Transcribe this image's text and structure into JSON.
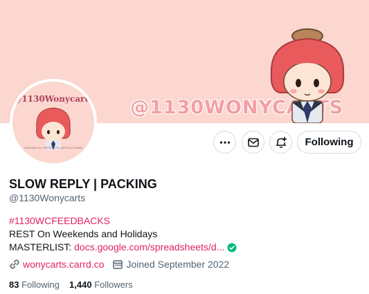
{
  "banner": {
    "text": "@1130WONYCARTS"
  },
  "avatar": {
    "title": "@1130Wonycarts",
    "caption": "ONGOING ALL PRODUCTS | ARTS ALLOWED"
  },
  "actions": {
    "more_icon": "more-icon",
    "message_icon": "mail-icon",
    "notify_icon": "bell-plus-icon",
    "follow_label": "Following"
  },
  "profile": {
    "name": "SLOW REPLY | PACKING",
    "handle": "@1130Wonycarts",
    "bio_hashtag": "#1130WCFEEDBACKS",
    "bio_line2": "REST On Weekends and Holidays",
    "bio_line3_prefix": "MASTERLIST: ",
    "bio_line3_link": "docs.google.com/spreadsheets/d..."
  },
  "meta": {
    "website": "wonycarts.carrd.co",
    "joined": "Joined September 2022"
  },
  "stats": {
    "following_count": "83",
    "following_label": "Following",
    "followers_count": "1,440",
    "followers_label": "Followers"
  },
  "colors": {
    "banner_bg": "#fbd7d0",
    "link": "#e0245e",
    "muted": "#536471",
    "verified": "#00ba7c"
  }
}
